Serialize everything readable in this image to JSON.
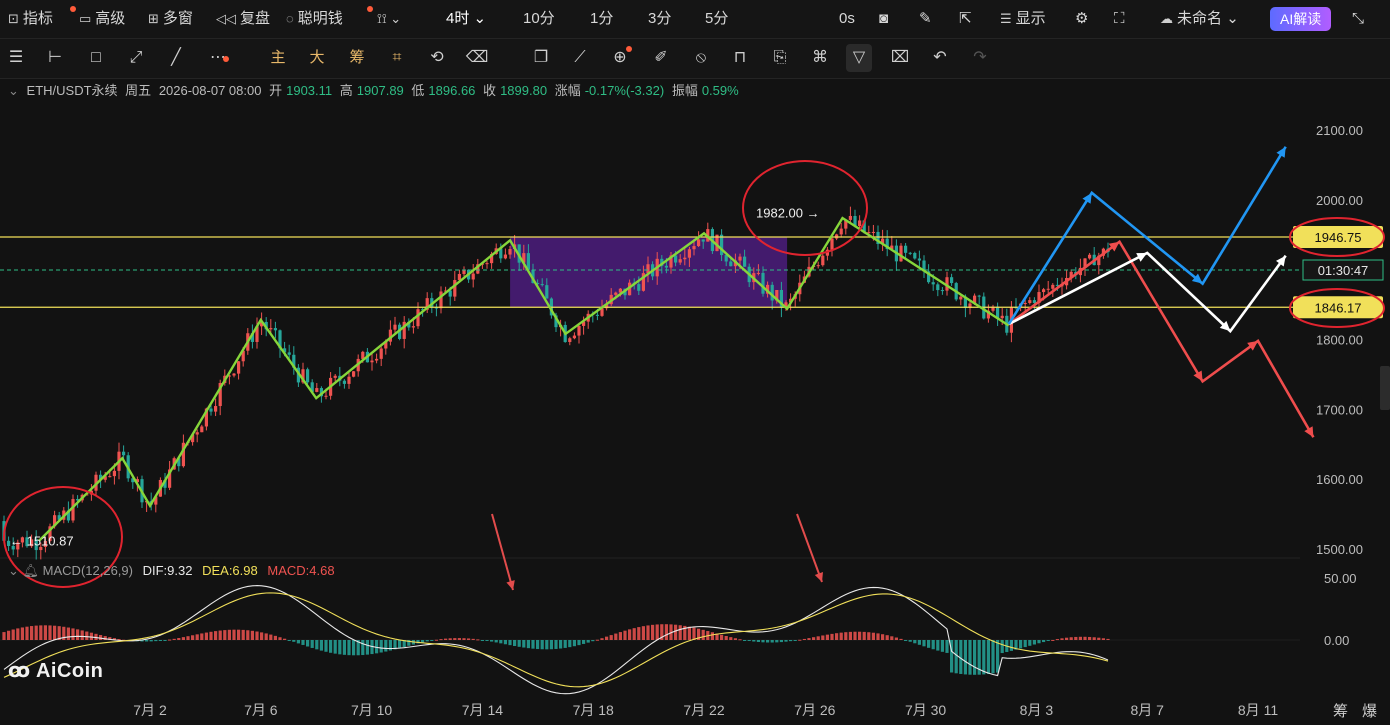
{
  "header": {
    "items": [
      {
        "id": "indicator",
        "label": "指标",
        "icon": "chart-icon",
        "dot": true
      },
      {
        "id": "advanced",
        "label": "高级",
        "icon": "window-icon"
      },
      {
        "id": "multi",
        "label": "多窗",
        "icon": "grid-icon"
      },
      {
        "id": "replay",
        "label": "复盘",
        "icon": "rewind-icon"
      },
      {
        "id": "smart",
        "label": "聪明钱",
        "icon": "smart-money-icon",
        "dot": true
      },
      {
        "id": "more",
        "label": "",
        "icon": "waveform-icon"
      }
    ],
    "timeframe_selected": "4时",
    "timeframes": [
      "10分",
      "1分",
      "3分",
      "5分"
    ],
    "countdown": "0s",
    "display_label": "显示",
    "layout_name": "未命名",
    "ai_button": "AI解读"
  },
  "toolbar": {
    "color_tools": [
      "主",
      "大",
      "筹"
    ]
  },
  "info": {
    "symbol": "ETH/USDT永续",
    "weekday": "周五",
    "datetime": "2026-08-07 08:00",
    "open_label": "开",
    "open": "1903.11",
    "high_label": "高",
    "high": "1907.89",
    "low_label": "低",
    "low": "1896.66",
    "close_label": "收",
    "close": "1899.80",
    "change_label": "涨幅",
    "change": "-0.17%(-3.32)",
    "amp_label": "振幅",
    "amp": "0.59%"
  },
  "macd": {
    "name": "MACD(12,26,9)",
    "dif": "DIF:9.32",
    "dea": "DEA:6.98",
    "hist": "MACD:4.68"
  },
  "logo": "AiCoin",
  "footer_right": [
    "筹",
    "爆"
  ],
  "colors": {
    "up": "#ef5350",
    "down": "#26a69a",
    "zigzag": "#86d63a",
    "level": "#f1e05a",
    "box": "#6b22b8",
    "blue": "#2196f3",
    "red": "#ef4d4d",
    "white": "#ffffff",
    "circle": "#e0242f"
  },
  "chart_data": {
    "type": "candlestick",
    "symbol": "ETH/USDT",
    "interval": "4h",
    "price_axis": {
      "ticks": [
        2100,
        2000,
        1900,
        1800,
        1700,
        1600,
        1500
      ],
      "tick_labels": [
        "2100.00",
        "2000.00",
        "1900.00",
        "1800.00",
        "1700.00",
        "1600.00",
        "1500.00"
      ]
    },
    "x_ticks": [
      "7月 2",
      "7月 6",
      "7月 10",
      "7月 14",
      "7月 18",
      "7月 22",
      "7月 26",
      "7月 30",
      "8月 3",
      "8月 7",
      "8月 11"
    ],
    "levels": [
      {
        "value": 1946.75,
        "label": "1946.75"
      },
      {
        "value": 1846.17,
        "label": "1846.17"
      }
    ],
    "current_price_countdown": "01:30:47",
    "annotations": [
      {
        "text": "1982.00 →",
        "price": 1982.0
      },
      {
        "text": "← 1510.87",
        "price": 1510.87
      }
    ],
    "zigzag": [
      {
        "x": "06-28",
        "y": 1512
      },
      {
        "x": "07-01",
        "y": 1630
      },
      {
        "x": "07-02",
        "y": 1562
      },
      {
        "x": "07-06",
        "y": 1828
      },
      {
        "x": "07-08",
        "y": 1716
      },
      {
        "x": "07-15",
        "y": 1942
      },
      {
        "x": "07-17",
        "y": 1808
      },
      {
        "x": "07-22",
        "y": 1952
      },
      {
        "x": "07-25",
        "y": 1844
      },
      {
        "x": "07-27",
        "y": 1974
      },
      {
        "x": "08-02",
        "y": 1820
      }
    ],
    "projections": {
      "blue": [
        {
          "x": "08-02",
          "y": 1822
        },
        {
          "x": "08-05",
          "y": 2010
        },
        {
          "x": "08-09",
          "y": 1880
        },
        {
          "x": "08-12",
          "y": 2076
        }
      ],
      "white": [
        {
          "x": "08-02",
          "y": 1822
        },
        {
          "x": "08-07",
          "y": 1924
        },
        {
          "x": "08-10",
          "y": 1812
        },
        {
          "x": "08-12",
          "y": 1920
        }
      ],
      "red": [
        {
          "x": "08-02",
          "y": 1822
        },
        {
          "x": "08-06",
          "y": 1940
        },
        {
          "x": "08-09",
          "y": 1740
        },
        {
          "x": "08-11",
          "y": 1798
        },
        {
          "x": "08-13",
          "y": 1660
        }
      ]
    },
    "macd_axis": {
      "ticks": [
        "50.00",
        "0.00"
      ]
    }
  }
}
